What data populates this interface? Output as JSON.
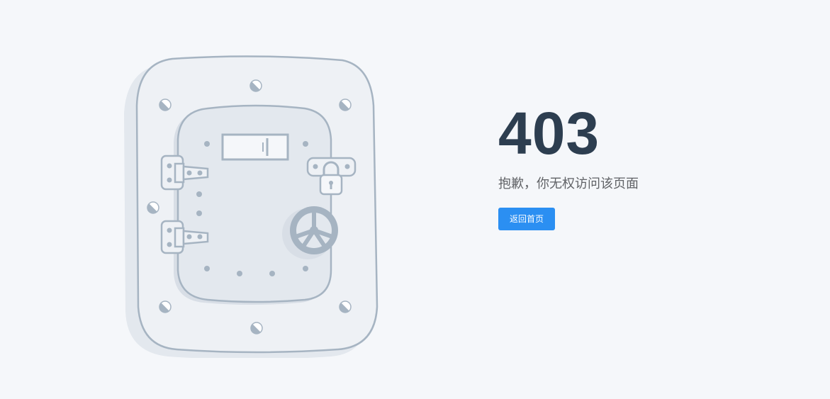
{
  "error": {
    "code": "403",
    "message": "抱歉，你无权访问该页面",
    "home_button_label": "返回首页"
  },
  "colors": {
    "background": "#f5f7fa",
    "code_text": "#2d3e50",
    "message_text": "#606266",
    "button_bg": "#2b8ff2",
    "illustration_stroke": "#a6b4c2",
    "illustration_fill": "#eef1f5"
  }
}
